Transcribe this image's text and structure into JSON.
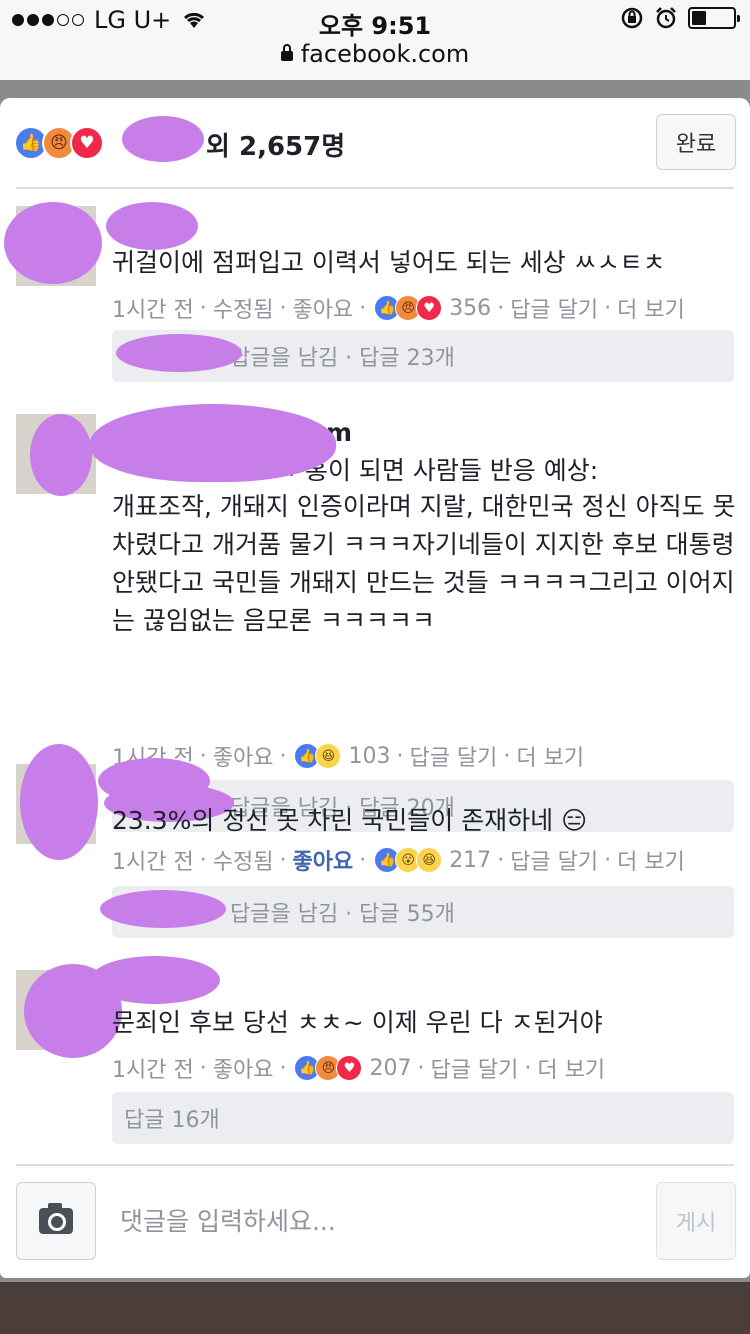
{
  "status_bar": {
    "carrier": "LG U+",
    "time": "오후 9:51",
    "icons": [
      "signal-dots-icon",
      "wifi-icon",
      "orientation-lock-icon",
      "alarm-icon",
      "battery-icon"
    ]
  },
  "browser": {
    "url": "facebook.com"
  },
  "reactions_header": {
    "reaction_icons": [
      "like",
      "angry",
      "love"
    ],
    "summary": "외 2,657명",
    "done_label": "완료"
  },
  "comments": [
    {
      "text": "귀걸이에 점퍼입고 이력서 넣어도 되는 세상 ㅆㅅㅌㅊ",
      "time": "1시간 전",
      "edited": "수정됨",
      "like_label": "좋아요",
      "liked": false,
      "reaction_icons": [
        "like",
        "angry",
        "love"
      ],
      "reaction_count": "356",
      "reply_label": "답글 달기",
      "more_label": "더 보기",
      "reply_summary": "답글을 남김 · 답글 23개"
    },
    {
      "name_tail": "m",
      "first_line": "ㅋ 홍이 되면 사람들 반응 예상:",
      "text": "개표조작, 개돼지 인증이라며 지랄, 대한민국 정신 아직도 못차렸다고 개거품 물기 ㅋㅋㅋ자기네들이 지지한 후보 대통령 안됐다고 국민들 개돼지 만드는 것들 ㅋㅋㅋㅋ그리고 이어지는 끊임없는 음모론 ㅋㅋㅋㅋㅋ",
      "time": "1시간 전",
      "like_label": "좋아요",
      "liked": false,
      "reaction_icons": [
        "like",
        "haha"
      ],
      "reaction_count": "103",
      "reply_label": "답글 달기",
      "more_label": "더 보기",
      "reply_summary": "답글을 남김 · 답글 20개"
    },
    {
      "text": "23.3%의 정신 못 차린 국민들이 존재하네 😑",
      "time": "1시간 전",
      "edited": "수정됨",
      "like_label": "좋아요",
      "liked": true,
      "reaction_icons": [
        "like",
        "wow",
        "haha"
      ],
      "reaction_count": "217",
      "reply_label": "답글 달기",
      "more_label": "더 보기",
      "reply_summary": "답글을 남김 · 답글 55개"
    },
    {
      "text": "문죄인 후보 당선 ㅊㅊ~ 이제 우린 다 ㅈ된거야",
      "time": "1시간 전",
      "like_label": "좋아요",
      "liked": false,
      "reaction_icons": [
        "like",
        "angry",
        "love"
      ],
      "reaction_count": "207",
      "reply_label": "답글 달기",
      "more_label": "더 보기",
      "reply_summary": "답글 16개"
    }
  ],
  "composer": {
    "placeholder": "댓글을 입력하세요...",
    "post_label": "게시",
    "camera_icon": "camera-icon"
  },
  "colors": {
    "like_blue": "#4b7bec",
    "liked_text": "#4267b2",
    "meta_gray": "#90949c",
    "redaction": "#c77ee8"
  }
}
